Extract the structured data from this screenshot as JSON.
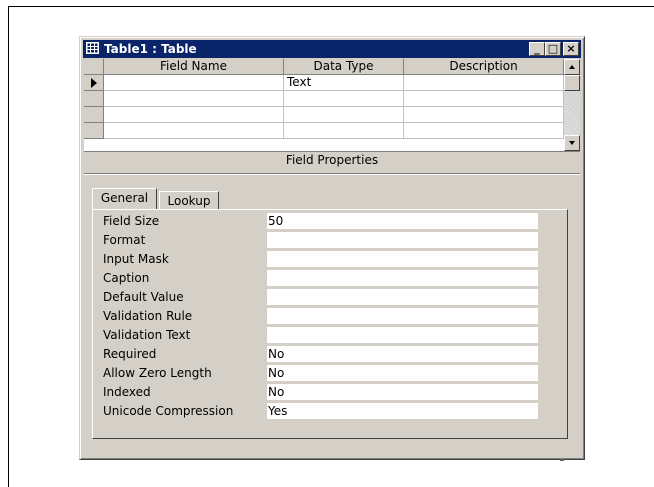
{
  "window": {
    "title": "Table1 : Table",
    "controls": {
      "minimize": "_",
      "maximize": "□",
      "close": "×"
    }
  },
  "grid": {
    "columns": [
      "Field Name",
      "Data Type",
      "Description"
    ],
    "rows": [
      {
        "field_name": "",
        "data_type": "Text",
        "description": "",
        "current": true
      },
      {
        "field_name": "",
        "data_type": "",
        "description": ""
      },
      {
        "field_name": "",
        "data_type": "",
        "description": ""
      },
      {
        "field_name": "",
        "data_type": "",
        "description": ""
      }
    ]
  },
  "field_properties": {
    "title": "Field Properties",
    "tabs": [
      "General",
      "Lookup"
    ],
    "active_tab": "General",
    "properties": [
      {
        "label": "Field Size",
        "value": "50"
      },
      {
        "label": "Format",
        "value": ""
      },
      {
        "label": "Input Mask",
        "value": ""
      },
      {
        "label": "Caption",
        "value": ""
      },
      {
        "label": "Default Value",
        "value": ""
      },
      {
        "label": "Validation Rule",
        "value": ""
      },
      {
        "label": "Validation Text",
        "value": ""
      },
      {
        "label": "Required",
        "value": "No"
      },
      {
        "label": "Allow Zero Length",
        "value": "No"
      },
      {
        "label": "Indexed",
        "value": "No"
      },
      {
        "label": "Unicode Compression",
        "value": "Yes"
      }
    ]
  },
  "icons": {
    "title_icon": "table-icon",
    "row_selector": "current-row-arrow-icon"
  }
}
